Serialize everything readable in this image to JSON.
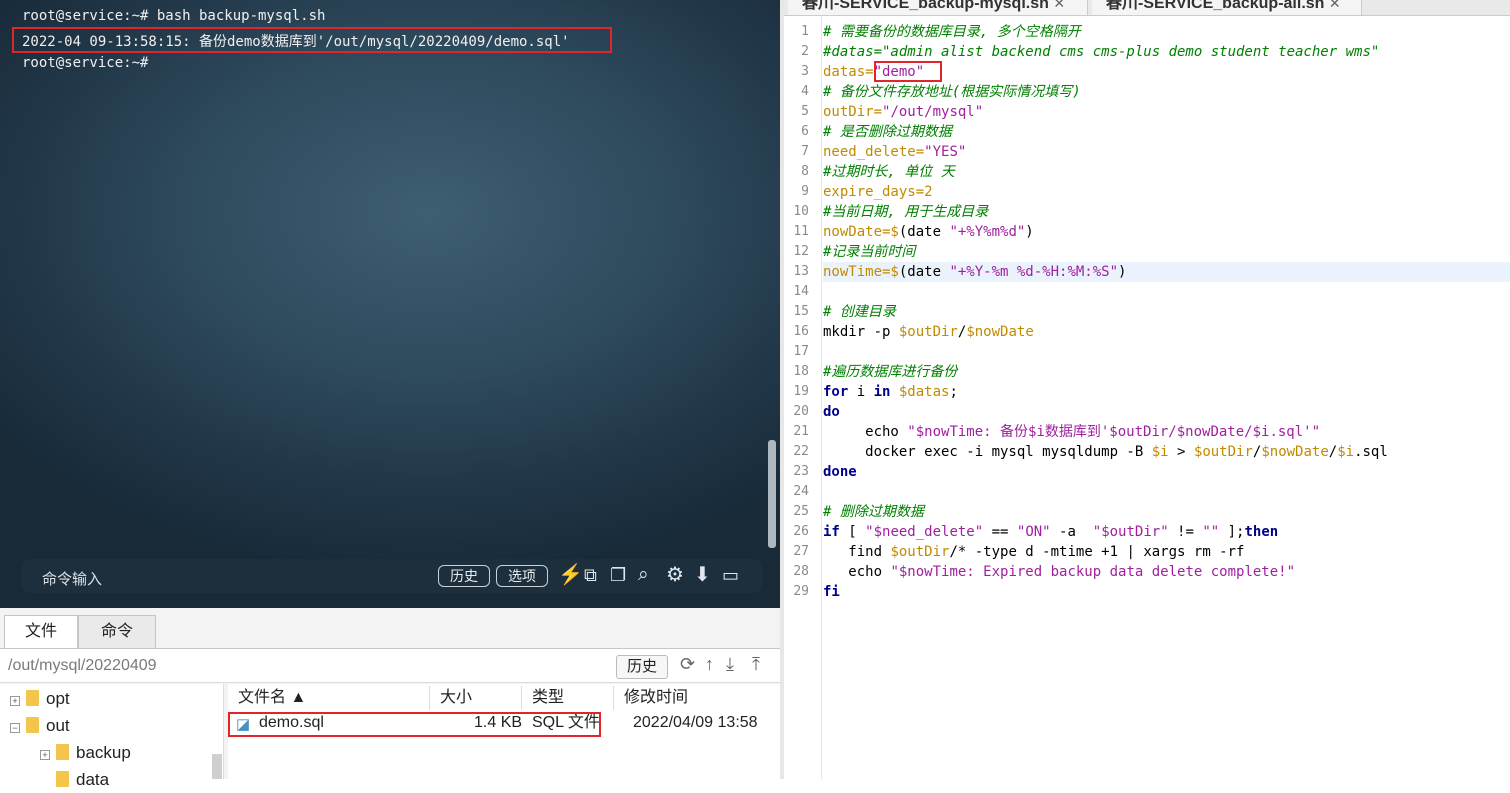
{
  "terminal": {
    "line1": "root@service:~# bash backup-mysql.sh",
    "line2": "2022-04 09-13:58:15: 备份demo数据库到'/out/mysql/20220409/demo.sql'",
    "line3": "root@service:~#",
    "cmd_placeholder": "命令输入",
    "history_btn": "历史",
    "options_btn": "选项"
  },
  "bottom_tabs": [
    "文件",
    "命令"
  ],
  "path": "/out/mysql/20220409",
  "path_history_btn": "历史",
  "tree": [
    {
      "label": "opt",
      "expander": "+"
    },
    {
      "label": "out",
      "expander": "−"
    },
    {
      "label": "backup",
      "expander": "+"
    },
    {
      "label": "data",
      "expander": ""
    }
  ],
  "file_columns": [
    "文件名 ▲",
    "大小",
    "类型",
    "修改时间"
  ],
  "files": [
    {
      "name": "demo.sql",
      "size": "1.4 KB",
      "type": "SQL 文件",
      "modified": "2022/04/09 13:58"
    }
  ],
  "editor_tabs": [
    "春川-SERVICE_backup-mysql.sh",
    "春川-SERVICE_backup-all.sh"
  ],
  "line_numbers": [
    "1",
    "2",
    "3",
    "4",
    "5",
    "6",
    "7",
    "8",
    "9",
    "10",
    "11",
    "12",
    "13",
    "14",
    "15",
    "16",
    "17",
    "18",
    "19",
    "20",
    "21",
    "22",
    "23",
    "24",
    "25",
    "26",
    "27",
    "28",
    "29"
  ],
  "code": {
    "l1": "# 需要备份的数据库目录, 多个空格隔开",
    "l2": "#datas=\"admin alist backend cms cms-plus demo student teacher wms\"",
    "l3a": "datas=",
    "l3b": "\"demo\"",
    "l4": "# 备份文件存放地址(根据实际情况填写)",
    "l5a": "outDir=",
    "l5b": "\"/out/mysql\"",
    "l6": "# 是否删除过期数据",
    "l7a": "need_delete=",
    "l7b": "\"YES\"",
    "l8": "#过期时长, 单位 天",
    "l9": "expire_days=2",
    "l10": "#当前日期, 用于生成目录",
    "l11a": "nowDate=$",
    "l11b": "(date ",
    "l11c": "\"+%Y%m%d\"",
    "l11d": ")",
    "l12": "#记录当前时间",
    "l13a": "nowTime=$",
    "l13b": "(date ",
    "l13c": "\"+%Y-%m %d-%H:%M:%S\"",
    "l13d": ")",
    "l15": "# 创建目录",
    "l16a": "mkdir -p ",
    "l16b": "$outDir",
    "l16c": "/",
    "l16d": "$nowDate",
    "l18": "#遍历数据库进行备份",
    "l19a": "for",
    "l19b": " i ",
    "l19c": "in",
    "l19d": " $datas",
    "l19e": ";",
    "l20": "do",
    "l21a": "     echo ",
    "l21b": "\"$nowTime: 备份$i数据库到'$outDir/$nowDate/$i.sql'\"",
    "l22a": "     docker exec -i mysql mysqldump -B ",
    "l22b": "$i",
    "l22c": " > ",
    "l22d": "$outDir",
    "l22e": "/",
    "l22f": "$nowDate",
    "l22g": "/",
    "l22h": "$i",
    "l22i": ".sql",
    "l23": "done",
    "l25": "# 删除过期数据",
    "l26a": "if",
    "l26b": " [ ",
    "l26c": "\"$need_delete\"",
    "l26d": " == ",
    "l26e": "\"ON\"",
    "l26f": " -a  ",
    "l26g": "\"$outDir\"",
    "l26h": " != ",
    "l26i": "\"\"",
    "l26j": " ];",
    "l26k": "then",
    "l27a": "   find ",
    "l27b": "$outDir",
    "l27c": "/* -type d -mtime +1 | xargs rm -rf",
    "l28a": "   echo ",
    "l28b": "\"$nowTime: Expired backup data delete complete!\"",
    "l29": "fi"
  }
}
